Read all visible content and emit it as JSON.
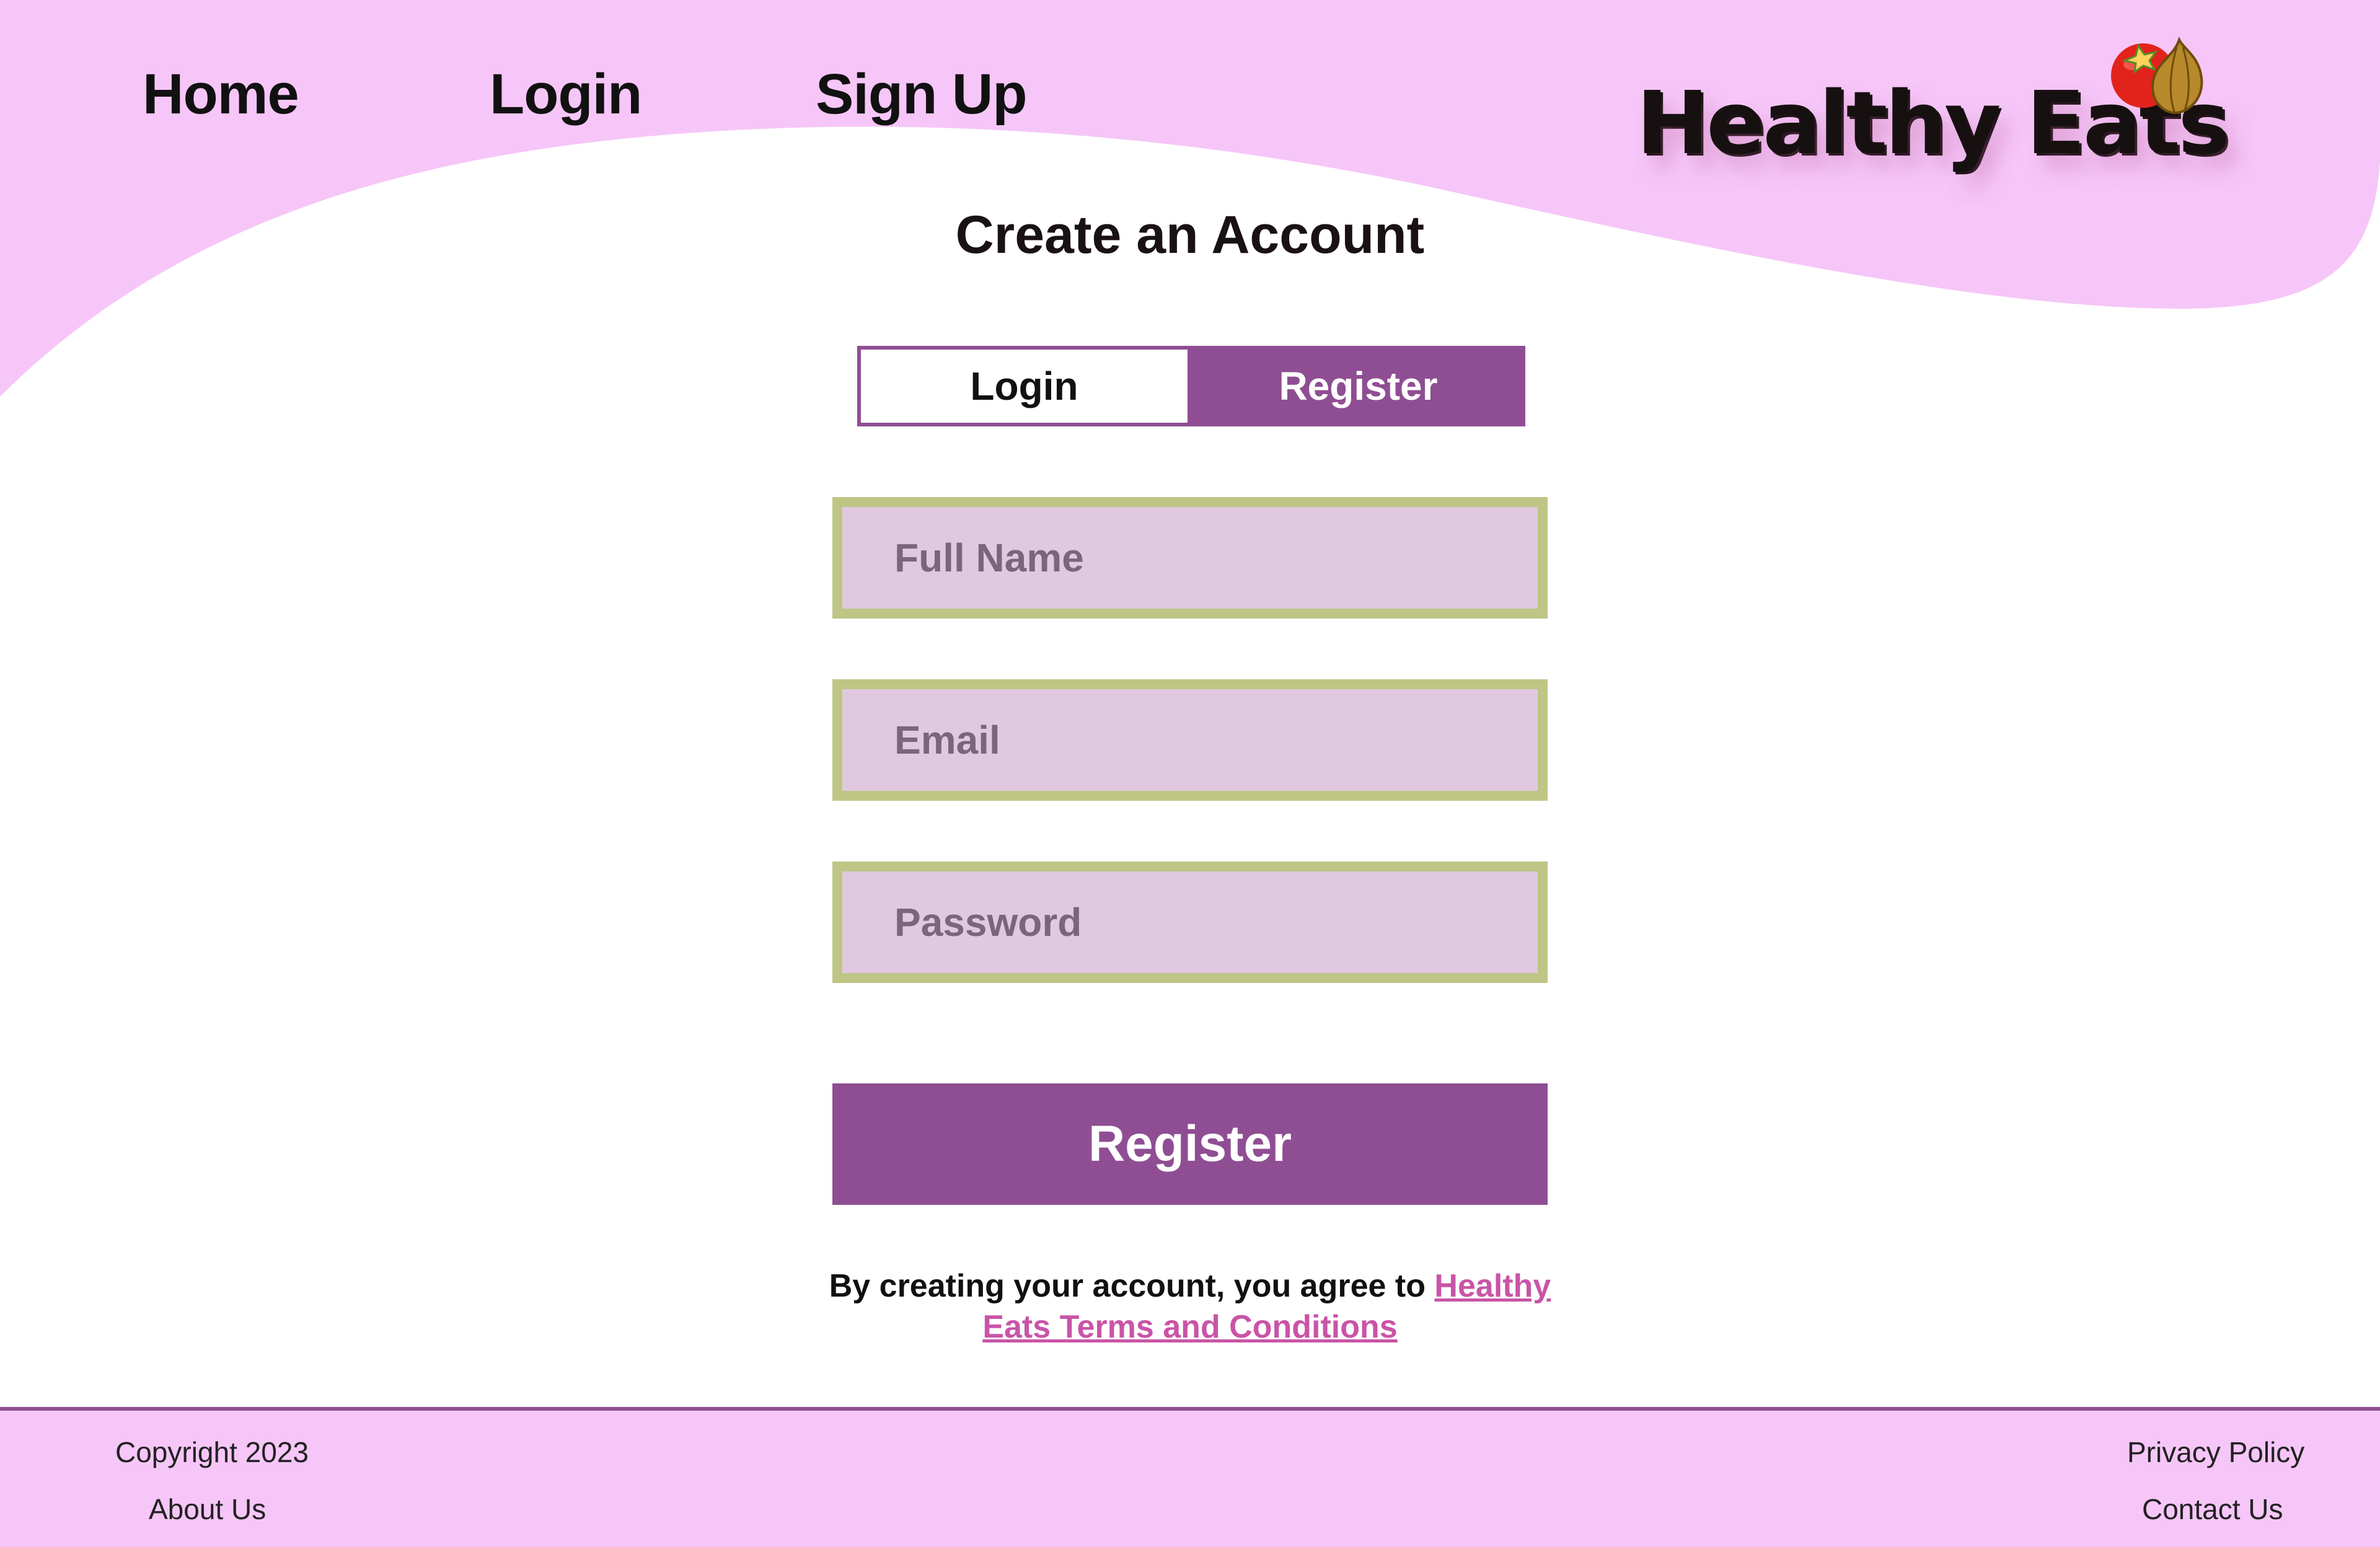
{
  "nav": {
    "home": "Home",
    "login": "Login",
    "signup": "Sign Up"
  },
  "logo": {
    "text": "Healthy Eats",
    "icons": [
      "tomato-icon",
      "onion-icon"
    ]
  },
  "page": {
    "title": "Create an Account"
  },
  "auth_toggle": {
    "login": "Login",
    "register": "Register",
    "active": "Register"
  },
  "form": {
    "full_name_placeholder": "Full Name",
    "email_placeholder": "Email",
    "password_placeholder": "Password",
    "full_name_value": "",
    "email_value": "",
    "password_value": "",
    "submit_label": "Register"
  },
  "terms": {
    "prefix": "By creating your account, you agree to",
    "link_text": "Healthy Eats Terms and Conditions"
  },
  "footer": {
    "copyright": "Copyright 2023",
    "about": "About Us",
    "privacy": "Privacy Policy",
    "contact": "Contact Us"
  },
  "colors": {
    "header_bg": "#f6c6f8",
    "accent_purple": "#8f4e93",
    "field_bg": "#e0c9e0",
    "field_border": "#bfc585",
    "terms_link": "#c954a7"
  }
}
